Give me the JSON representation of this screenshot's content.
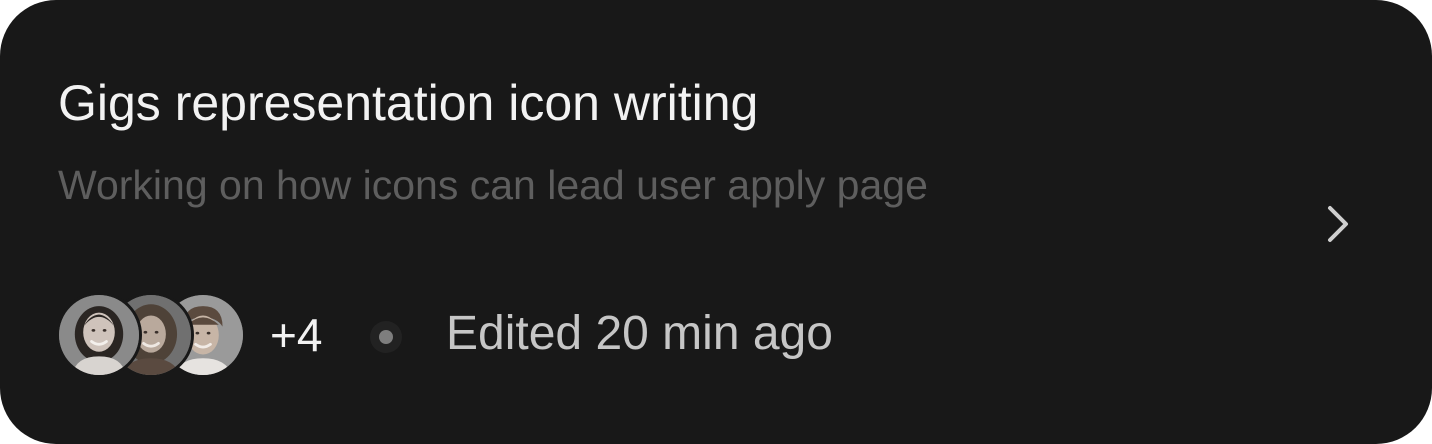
{
  "card": {
    "title": "Gigs representation icon writing",
    "subtitle": "Working on how icons can lead user apply page",
    "extra_collaborators": "+4",
    "edited_status": "Edited 20 min ago"
  },
  "icons": {
    "open": "chevron-right-icon",
    "separator": "dot-separator"
  },
  "colors": {
    "card_background": "#181818",
    "title": "#f2f2f2",
    "subtitle": "#5e5e5e",
    "meta": "#c6c6c6"
  },
  "collaborators": [
    {
      "avatar": "avatar-woman-dark-hair"
    },
    {
      "avatar": "avatar-woman-curly-hair"
    },
    {
      "avatar": "avatar-man-curly-hair"
    }
  ]
}
